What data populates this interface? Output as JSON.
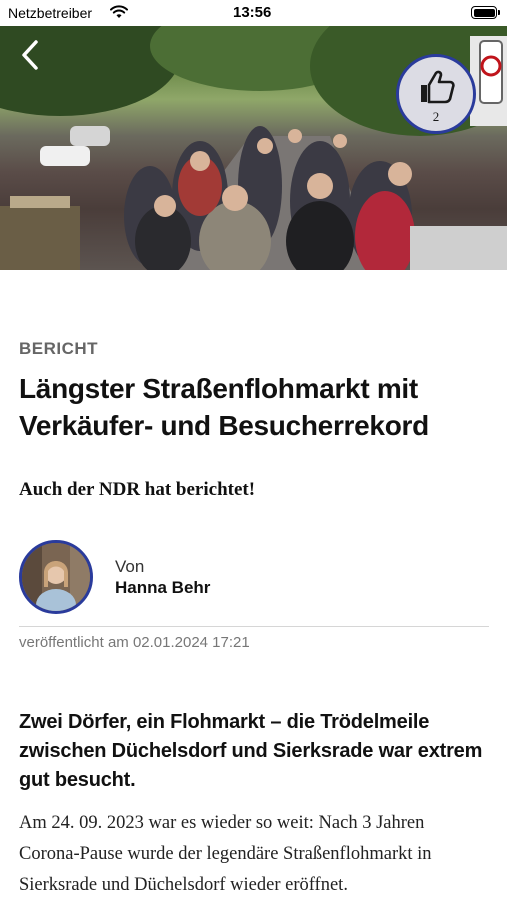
{
  "status_bar": {
    "carrier": "Netzbetreiber",
    "time": "13:56"
  },
  "hero": {
    "like_count": "2"
  },
  "article": {
    "category": "BERICHT",
    "headline": "Längster Straßenflohmarkt mit Verkäufer- und Besucherrekord",
    "subtitle": "Auch der NDR hat berichtet!",
    "author": {
      "by_label": "Von",
      "name": "Hanna Behr"
    },
    "published": "veröffentlicht am 02.01.2024 17:21",
    "lead": "Zwei Dörfer, ein Flohmarkt – die Trödelmeile zwischen Düchelsdorf und Sierksrade war extrem gut besucht.",
    "body": "Am 24. 09. 2023 war es wieder so weit: Nach 3 Jahren Corona-Pause wurde der legendäre Straßenflohmarkt in Sierksrade und Düchelsdorf wieder eröffnet."
  },
  "colors": {
    "accent_ring": "#2a3b9c",
    "category_gray": "#666666",
    "divider": "#d6d6d6"
  }
}
